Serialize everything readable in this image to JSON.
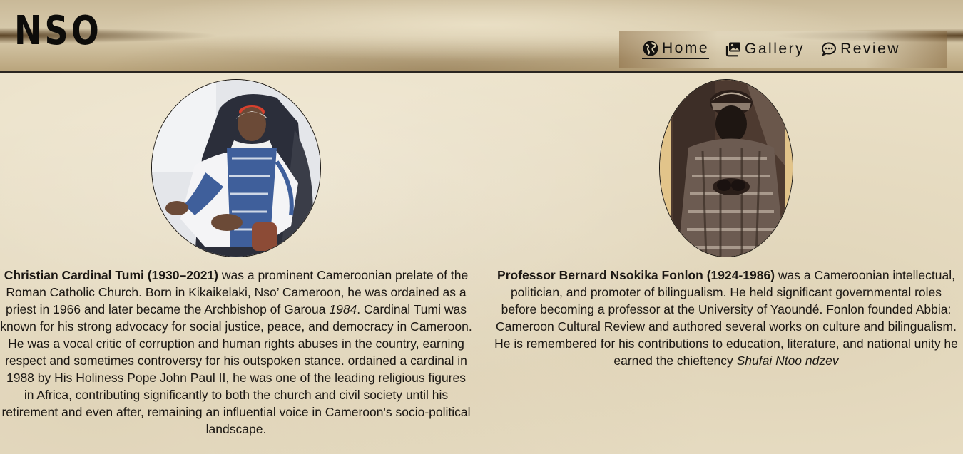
{
  "site": {
    "logo": "NSO"
  },
  "nav": {
    "items": [
      {
        "label": "Home",
        "icon": "globe-icon",
        "active": true
      },
      {
        "label": "Gallery",
        "icon": "images-icon",
        "active": false
      },
      {
        "label": "Review",
        "icon": "chat-bubble-icon",
        "active": false
      }
    ]
  },
  "profiles": [
    {
      "name": "Christian Cardinal Tumi (1930–2021)",
      "bio_part1": " was a prominent Cameroonian prelate of the Roman Catholic Church. Born in Kikaikelaki, Nso’ Cameroon, he was ordained as a priest in 1966 and later became the Archbishop of Garoua ",
      "bio_italic": "1984",
      "bio_part2": ". Cardinal Tumi was known for his strong advocacy for social justice, peace, and democracy in Cameroon. He was a vocal critic of corruption and human rights abuses in the country, earning respect and sometimes controversy for his outspoken stance. ordained a cardinal in 1988 by His Holiness Pope John Paul II, he was one of the leading religious figures in Africa, contributing significantly to both the church and civil society until his retirement and even after, remaining an influential voice in Cameroon's socio-political landscape."
    },
    {
      "name": "Professor Bernard Nsokika Fonlon (1924-1986)",
      "bio_part1": " was a Cameroonian intellectual, politician, and promoter of bilingualism. He held significant governmental roles before becoming a professor at the University of Yaoundé. Fonlon founded Abbia: Cameroon Cultural Review and authored several works on culture and bilingualism. He is remembered for his contributions to education, literature, and national unity he earned the chieftency ",
      "bio_italic": "Shufai Ntoo ndzev",
      "bio_part2": ""
    }
  ],
  "colors": {
    "page_background": "#ebe1c8",
    "text": "#1b1713",
    "header_border": "#2a2520"
  }
}
